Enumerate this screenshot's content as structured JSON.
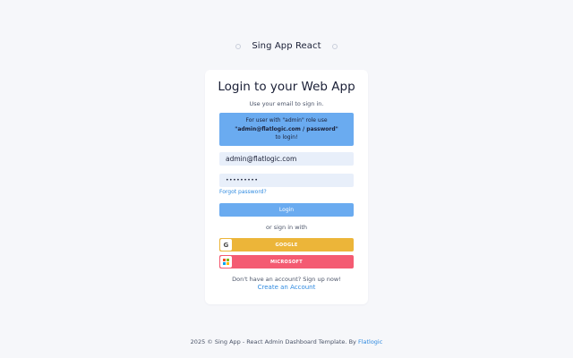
{
  "brand": {
    "name": "Sing App React"
  },
  "login": {
    "title": "Login to your Web App",
    "subtitle": "Use your email to sign in.",
    "info": {
      "line1": "For user with \"admin\" role use",
      "line2": "\"admin@flatlogic.com / password\"",
      "line3": "to login!"
    },
    "email_value": "admin@flatlogic.com",
    "password_value": "•••••••••",
    "forgot_label": "Forgot password?",
    "login_label": "Login",
    "or_label": "or sign in with",
    "google_label": "GOOGLE",
    "microsoft_label": "MICROSOFT",
    "no_account": "Don't have an account? Sign up now!",
    "create_label": "Create an Account"
  },
  "footer": {
    "text": "2025 © Sing App - React Admin Dashboard Template. By ",
    "link": "Flatlogic"
  },
  "colors": {
    "accent": "#6aabf0",
    "link": "#2f8ae0",
    "google": "#ecb539",
    "microsoft": "#f45b72",
    "input_bg": "#e8effa"
  },
  "icons": {
    "google": "google-logo-icon",
    "microsoft": "microsoft-logo-icon"
  }
}
